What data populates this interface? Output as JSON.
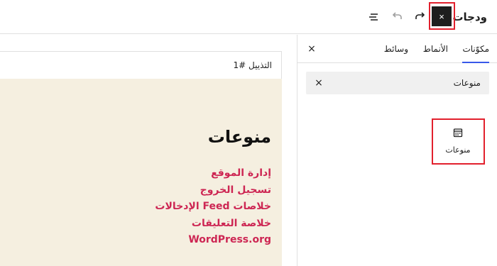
{
  "app": {
    "title": "ودجات",
    "close_label": "×",
    "undo_label": "undo",
    "redo_label": "redo",
    "list_view_label": "list view"
  },
  "inserter": {
    "tabs": [
      {
        "label": "مكوّنات",
        "active": true
      },
      {
        "label": "الأنماط",
        "active": false
      },
      {
        "label": "وسائط",
        "active": false
      }
    ],
    "close_label": "×",
    "search": {
      "value": "منوعات",
      "clear_label": "×"
    },
    "results": [
      {
        "label": "منوعات",
        "icon": "calendar-icon"
      }
    ]
  },
  "preview": {
    "header": "التذييل #1",
    "widget_title": "منوعات",
    "links": [
      "إدارة الموقع",
      "تسجيل الخروج",
      "خلاصات Feed الإدخالات",
      "خلاصة التعليقات",
      "WordPress.org"
    ]
  },
  "colors": {
    "accent": "#3858e9",
    "highlight": "#e2202d",
    "preview_background": "#f5efe0",
    "link": "#cd2653",
    "dark_button": "#1e1e1e"
  }
}
